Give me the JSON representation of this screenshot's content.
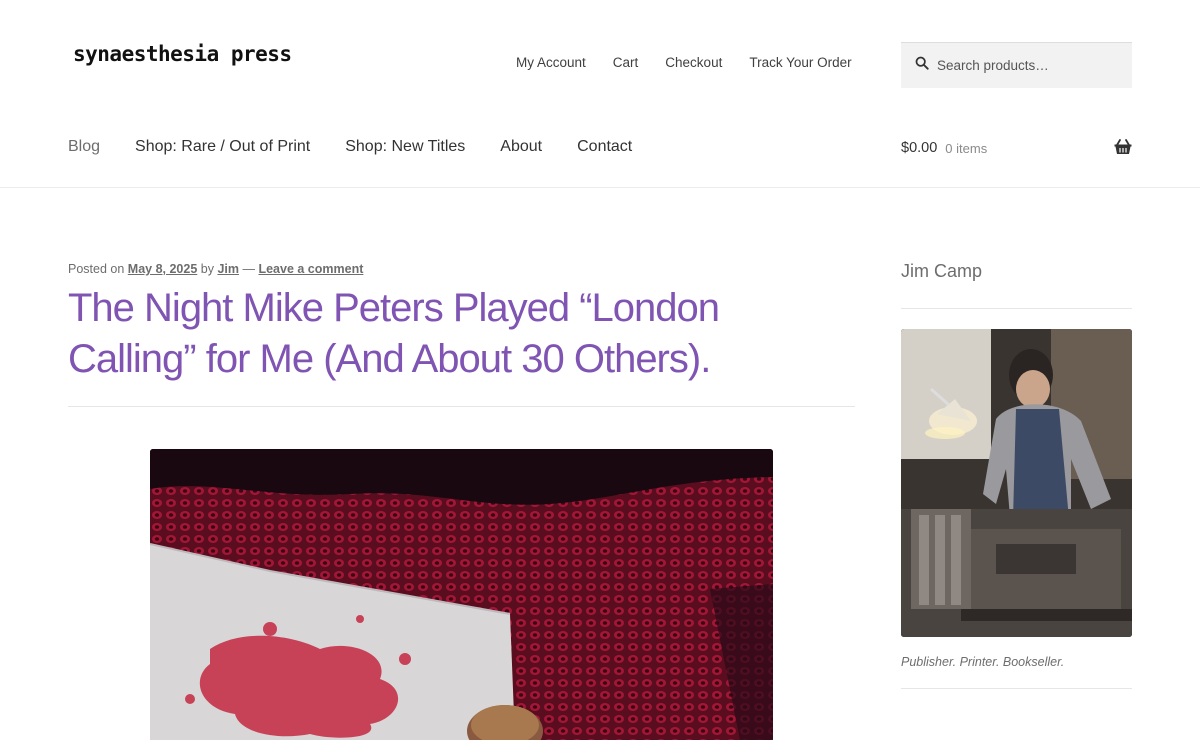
{
  "site": {
    "logo": "synaesthesia press"
  },
  "secondary_nav": [
    "My Account",
    "Cart",
    "Checkout",
    "Track Your Order"
  ],
  "search": {
    "placeholder": "Search products…"
  },
  "primary_nav": [
    "Blog",
    "Shop: Rare / Out of Print",
    "Shop: New Titles",
    "About",
    "Contact"
  ],
  "cart": {
    "amount": "$0.00",
    "count": "0 items"
  },
  "post": {
    "posted_on": "Posted on",
    "date": "May 8, 2025",
    "by": "by",
    "author": "Jim",
    "separator": "—",
    "comment_link": "Leave a comment",
    "title": "The Night Mike Peters Played “London Calling” for Me (And About 30 Others)."
  },
  "sidebar": {
    "widget_title": "Jim Camp",
    "caption": "Publisher. Printer. Bookseller."
  },
  "colors": {
    "accent": "#7f54b3",
    "text": "#43454b",
    "muted": "#6d6d6d"
  }
}
